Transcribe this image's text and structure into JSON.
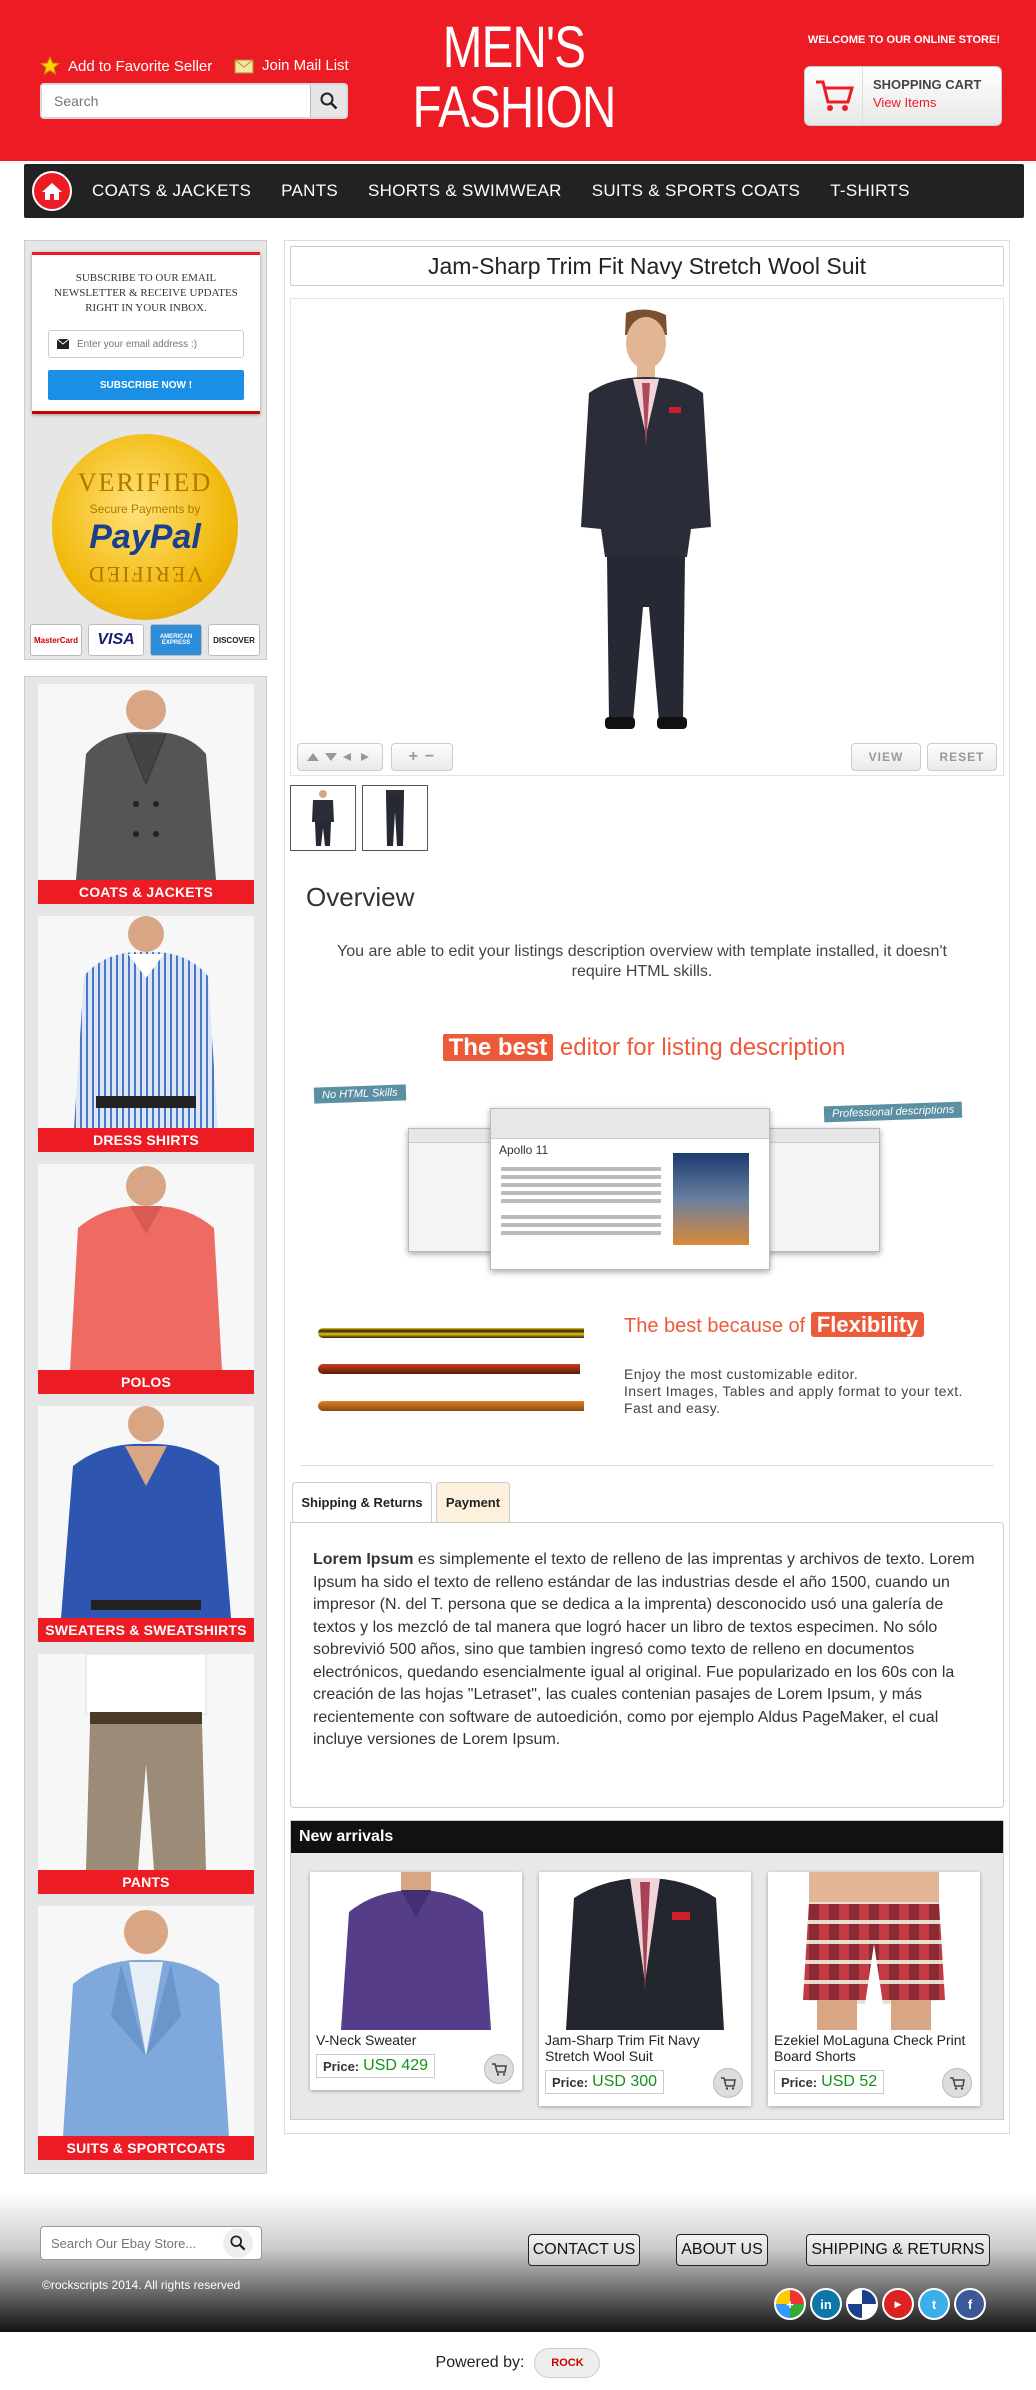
{
  "header": {
    "favorite_label": "Add to Favorite Seller",
    "mail_label": "Join Mail List",
    "search_placeholder": "Search",
    "logo_line1": "MEN'S",
    "logo_line2": "FASHION",
    "welcome": "WELCOME TO OUR ONLINE STORE!",
    "cart_title": "SHOPPING CART",
    "cart_sub": "View Items",
    "brand_color": "#ed1c24"
  },
  "nav": {
    "items": [
      "COATS & JACKETS",
      "PANTS",
      "SHORTS & SWIMWEAR",
      "SUITS & SPORTS COATS",
      "T-SHIRTS"
    ]
  },
  "sidebar": {
    "newsletter_text": "SUBSCRIBE TO OUR EMAIL NEWSLETTER & RECEIVE UPDATES RIGHT IN YOUR INBOX.",
    "email_placeholder": "Enter your email address :)",
    "subscribe_label": "SUBSCRIBE NOW !",
    "paypal_top": "VERIFIED",
    "paypal_mid": "Secure Payments by",
    "paypal_brand": "PayPal",
    "paypal_bottom": "VERIFIED",
    "cards": [
      "MasterCard",
      "VISA",
      "AMERICAN EXPRESS",
      "DISCOVER"
    ],
    "categories": [
      "COATS & JACKETS",
      "DRESS SHIRTS",
      "POLOS",
      "SWEATERS & SWEATSHIRTS",
      "PANTS",
      "SUITS & SPORTCOATS"
    ]
  },
  "product": {
    "title": "Jam-Sharp Trim Fit Navy Stretch Wool Suit",
    "view_label": "VIEW",
    "reset_label": "RESET",
    "zoom_in": "+",
    "zoom_out": "−"
  },
  "overview": {
    "heading": "Overview",
    "text": "You are able to edit your listings description overview with template installed, it doesn't require HTML skills.",
    "best_hl": "The best",
    "best_rest": " editor for listing description",
    "tag_left": "No HTML Skills",
    "tag_right": "Professional descriptions",
    "editor_title": "Apollo 11",
    "flex_pre": "The best because of ",
    "flex_hl": "Flexibility",
    "flex_lines": [
      "Enjoy the most customizable editor.",
      "Insert Images, Tables and apply format to your text.",
      "Fast and easy."
    ]
  },
  "tabs": {
    "shipping": "Shipping & Returns",
    "payment": "Payment",
    "body_bold": "Lorem Ipsum",
    "body_text": " es simplemente el texto de relleno de las imprentas y archivos de texto. Lorem Ipsum ha sido el texto de relleno estándar de las industrias desde el año 1500, cuando un impresor (N. del T. persona que se dedica a la imprenta) desconocido usó una galería de textos y los mezcló de tal manera que logró hacer un libro de textos especimen. No sólo sobrevivió 500 años, sino que tambien ingresó como texto de relleno en documentos electrónicos, quedando esencialmente igual al original. Fue popularizado en los 60s con la creación de las hojas \"Letraset\", las cuales contenian pasajes de Lorem Ipsum, y más recientemente con software de autoedición, como por ejemplo Aldus PageMaker, el cual incluye versiones de Lorem Ipsum."
  },
  "new_arrivals": {
    "heading": "New arrivals",
    "price_label": "Price:",
    "items": [
      {
        "name": "V-Neck Sweater",
        "price": "USD 429"
      },
      {
        "name": "Jam-Sharp Trim Fit Navy Stretch Wool Suit",
        "price": "USD 300"
      },
      {
        "name": "Ezekiel MoLaguna Check Print Board Shorts",
        "price": "USD 52"
      }
    ]
  },
  "footer": {
    "search_placeholder": "Search Our Ebay Store...",
    "contact": "CONTACT US",
    "about": "ABOUT US",
    "shipping": "SHIPPING & RETURNS",
    "copyright": "©rockscripts 2014. All rights reserved",
    "powered": "Powered by:",
    "powered_logo": "ROCK"
  }
}
